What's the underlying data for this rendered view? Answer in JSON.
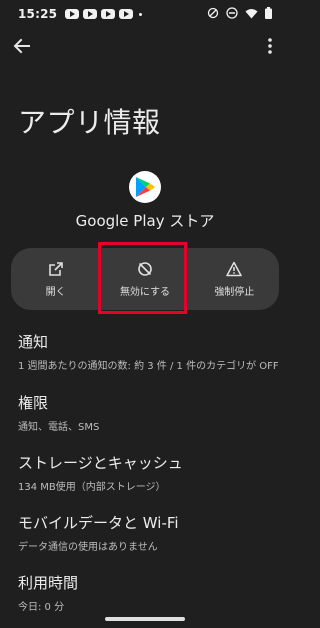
{
  "status_bar": {
    "time": "15:25"
  },
  "app_info": {
    "page_title": "アプリ情報",
    "app_name": "Google Play ストア"
  },
  "actions": [
    {
      "label": "開く",
      "icon": "open-external-icon"
    },
    {
      "label": "無効にする",
      "icon": "disable-icon"
    },
    {
      "label": "強制停止",
      "icon": "warning-icon"
    }
  ],
  "settings": [
    {
      "title": "通知",
      "subtitle": "1 週間あたりの通知の数: 約 3 件 / 1 件のカテゴリが OFF"
    },
    {
      "title": "権限",
      "subtitle": "通知、電話、SMS"
    },
    {
      "title": "ストレージとキャッシュ",
      "subtitle": "134 MB使用（内部ストレージ）"
    },
    {
      "title": "モバイルデータと Wi-Fi",
      "subtitle": "データ通信の使用はありません"
    },
    {
      "title": "利用時間",
      "subtitle": "今日: 0 分"
    }
  ],
  "colors": {
    "background": "#1f1f1f",
    "action_panel": "#3a3a3a",
    "highlight": "#e4002b"
  }
}
